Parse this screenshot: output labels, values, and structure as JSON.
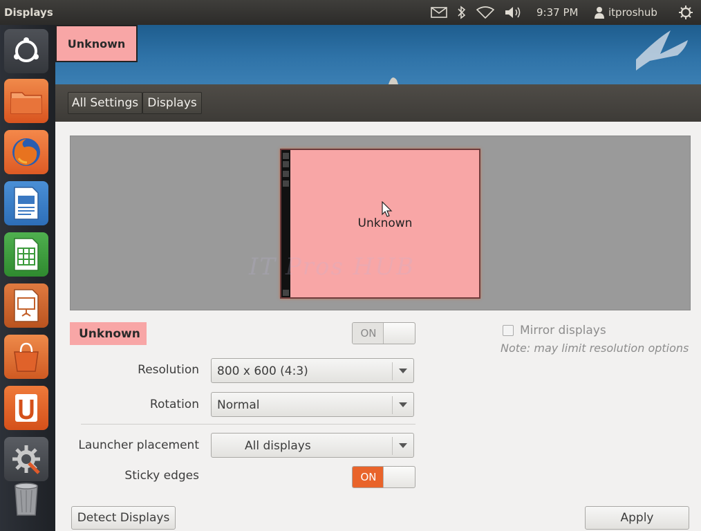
{
  "top_panel": {
    "window_title": "Displays",
    "clock": "9:37 PM",
    "user_name": "itproshub",
    "icons": [
      "mail-icon",
      "bluetooth-icon",
      "wifi-icon",
      "volume-icon",
      "user-icon",
      "power-gear-icon"
    ]
  },
  "launcher": {
    "items": [
      "dash-home",
      "files",
      "firefox",
      "libreoffice-writer",
      "libreoffice-calc",
      "libreoffice-impress",
      "software-center",
      "ubuntu-one",
      "system-settings",
      "trash"
    ]
  },
  "monitor_tag": "Unknown",
  "breadcrumb": {
    "all_settings": "All Settings",
    "displays": "Displays"
  },
  "preview": {
    "display_label": "Unknown",
    "watermark": "IT Pros HUB"
  },
  "display_name": "Unknown",
  "main_switch_label": "ON",
  "mirror": {
    "label": "Mirror displays",
    "note": "Note: may limit resolution options",
    "checked": false
  },
  "form": {
    "resolution_label": "Resolution",
    "resolution_value": "800 x 600 (4:3)",
    "rotation_label": "Rotation",
    "rotation_value": "Normal",
    "launcher_placement_label": "Launcher placement",
    "launcher_placement_value": "All displays",
    "sticky_edges_label": "Sticky edges",
    "sticky_edges_switch": "ON"
  },
  "buttons": {
    "detect_displays": "Detect Displays",
    "apply": "Apply"
  },
  "colors": {
    "accent_orange": "#e9642b",
    "monitor_pink": "#f8a6a6",
    "panel_dark": "#3c3b37"
  }
}
